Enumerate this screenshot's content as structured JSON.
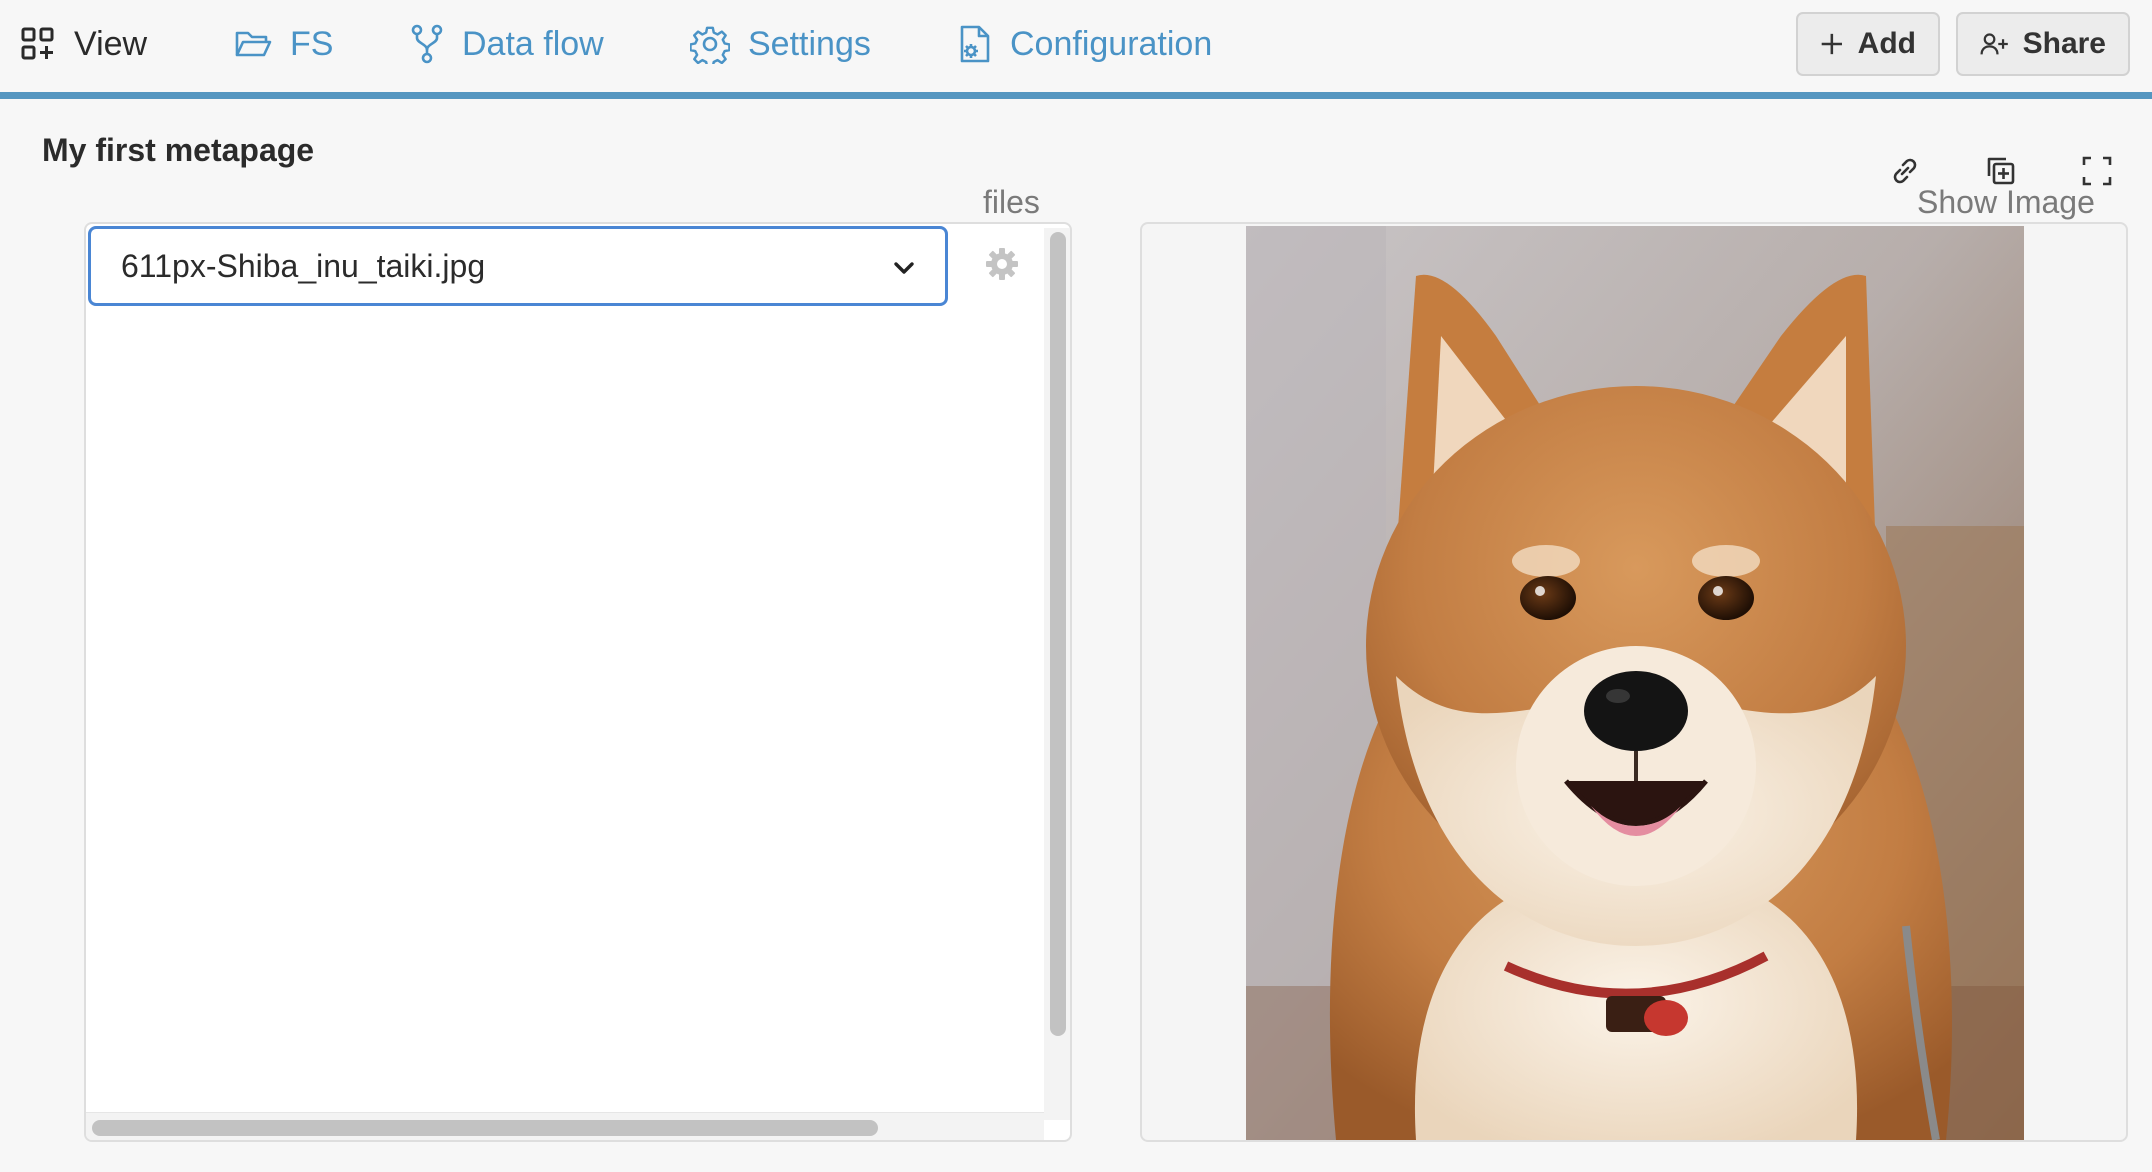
{
  "nav": {
    "view_label": "View",
    "fs_label": "FS",
    "dataflow_label": "Data flow",
    "settings_label": "Settings",
    "configuration_label": "Configuration",
    "accent_color": "#4a93c6",
    "rule_color": "#5596c0"
  },
  "toolbar": {
    "add_label": "Add",
    "share_label": "Share"
  },
  "page": {
    "title": "My first metapage"
  },
  "files_panel": {
    "label": "files",
    "selected_file": "611px-Shiba_inu_taiki.jpg",
    "icons": [
      "chevron-down-icon",
      "gear-icon"
    ]
  },
  "image_panel": {
    "label": "Show Image",
    "icons": [
      "link-icon",
      "copy-icon",
      "fullscreen-icon"
    ],
    "image_subject": "Shiba Inu dog photo"
  }
}
